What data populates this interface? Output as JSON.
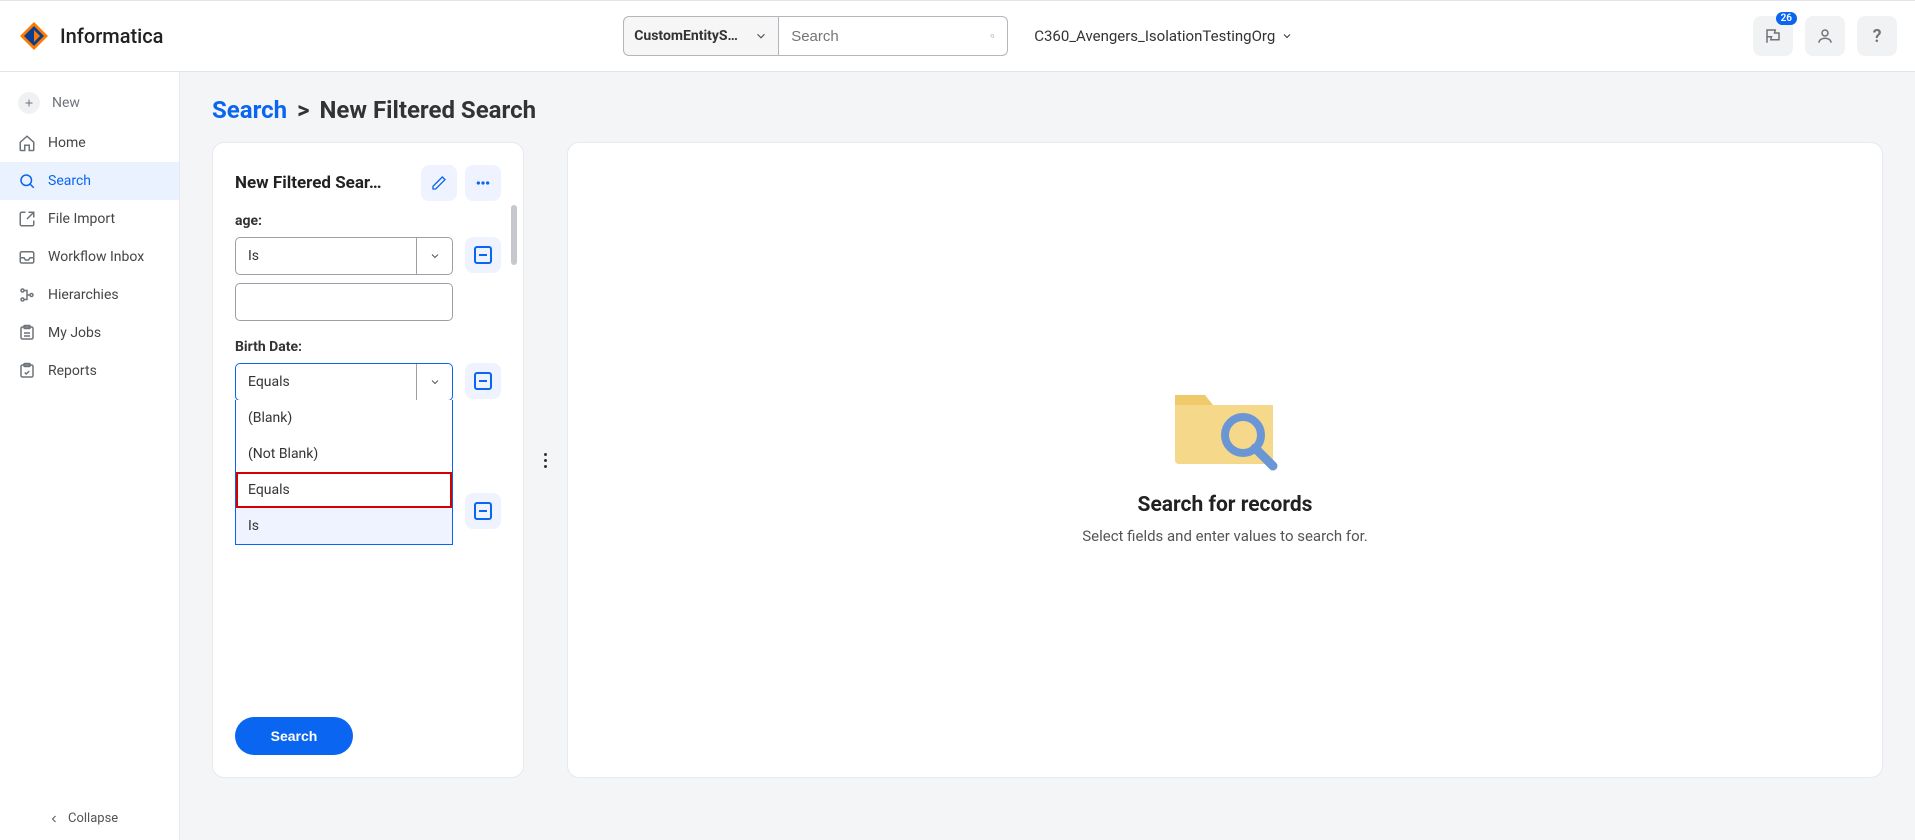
{
  "brand": {
    "name": "Informatica"
  },
  "header": {
    "entity_label": "CustomEntityS…",
    "search_placeholder": "Search",
    "org_name": "C360_Avengers_IsolationTestingOrg",
    "notif_count": "26"
  },
  "sidebar": {
    "items": [
      {
        "label": "New"
      },
      {
        "label": "Home"
      },
      {
        "label": "Search"
      },
      {
        "label": "File Import"
      },
      {
        "label": "Workflow Inbox"
      },
      {
        "label": "Hierarchies"
      },
      {
        "label": "My Jobs"
      },
      {
        "label": "Reports"
      }
    ],
    "collapse_label": "Collapse"
  },
  "breadcrumb": {
    "root": "Search",
    "sep": ">",
    "current": "New Filtered Search"
  },
  "filter": {
    "title": "New Filtered Sear…",
    "fields": {
      "age": {
        "label": "age:",
        "operator": "Is",
        "value": ""
      },
      "birthdate": {
        "label": "Birth Date:",
        "operator": "Equals",
        "options": [
          "(Blank)",
          "(Not Blank)",
          "Equals",
          "Is"
        ]
      }
    },
    "search_button": "Search"
  },
  "results": {
    "title": "Search for records",
    "subtitle": "Select fields and enter values to search for."
  }
}
